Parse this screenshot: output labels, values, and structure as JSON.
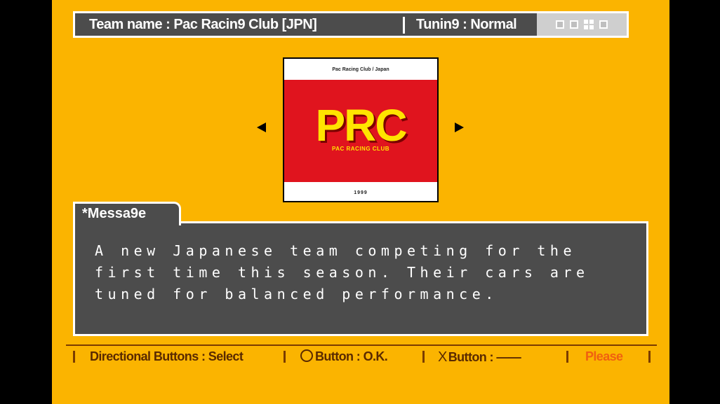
{
  "header": {
    "team_name": "Team name : Pac Racin9 Club [JPN]",
    "tuning": "Tunin9 : Normal",
    "icons": [
      "square-icon",
      "square-icon",
      "grid-icon",
      "square-icon"
    ]
  },
  "team_logo": {
    "top_text": "Pac Racing Club / Japan",
    "mark": "PRC",
    "sub_text": "PAC RACING CLUB",
    "year": "1999",
    "colors": {
      "background": "#E0141E",
      "mark": "#FFE400"
    }
  },
  "message": {
    "tab_label": "*Messa9e",
    "text": "A new Japanese team competing for the first time this season. Their cars are tuned for balanced performance."
  },
  "footer": {
    "directional": "Directional Buttons : Select",
    "circle": "Button : O.K.",
    "cross": "Button : ——",
    "cross_symbol": "X",
    "please": "Please"
  },
  "colors": {
    "screen_background": "#FBB400",
    "panel": "#4c4c4c",
    "footer_text": "#5a2a00",
    "please": "#f06010"
  }
}
